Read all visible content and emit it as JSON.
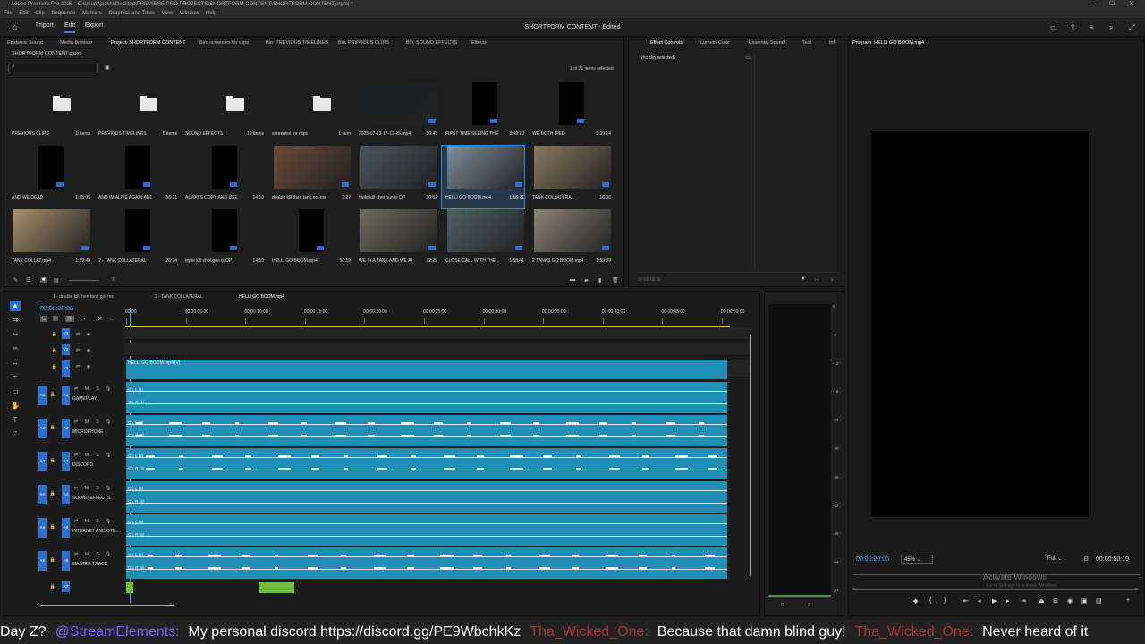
{
  "window": {
    "title": "Adobe Premiere Pro 2025 - C:\\Users\\jackm\\Desktop\\PREMIERE PRO PROJECTS\\SHORTFORM CONTENT\\SHORTFORM CONTENT.prproj *"
  },
  "menu": [
    "File",
    "Edit",
    "Clip",
    "Sequence",
    "Markers",
    "Graphics and Titles",
    "View",
    "Window",
    "Help"
  ],
  "workspace": {
    "import": "Import",
    "edit": "Edit",
    "export": "Export",
    "project_title": "SHORTFORM CONTENT - Edited"
  },
  "project_panel": {
    "tabs": [
      "Epidemic Sound",
      "Media Browser",
      "Project: SHORTFORM CONTENT",
      "Bin: screenies for clips",
      "Bin: PREVIOUS TIMELINES",
      "Bin: PREVIOUS CLIPS",
      "Bin: SOUND EFFECTS",
      "Effects"
    ],
    "file": "SHORTFORM CONTENT.prproj",
    "selection": "1 of 21 items selected",
    "items": [
      {
        "name": "PREVIOUS CLIPS",
        "info": "0 items",
        "kind": "folder"
      },
      {
        "name": "PREVIOUS TIMELINES",
        "info": "5 items",
        "kind": "folder"
      },
      {
        "name": "SOUND EFFECTS",
        "info": "10 items",
        "kind": "folder"
      },
      {
        "name": "screenies for clips",
        "info": "1 item",
        "kind": "folder"
      },
      {
        "name": "2025-07-13 17-12-25.mp4",
        "info": "56:43",
        "kind": "clip",
        "color": "#1a1e22"
      },
      {
        "name": "FIRST TIME SEEING THE ...",
        "info": "3:49:10",
        "kind": "seq",
        "color": "#050608"
      },
      {
        "name": "WE BOTH DIED",
        "info": "5:39:14",
        "kind": "seq",
        "color": "#000"
      },
      {
        "name": "AND WE DEAD",
        "info": "1:15:05",
        "kind": "seq",
        "color": "#000"
      },
      {
        "name": "AND IM ALIVE AGAIN AND...",
        "info": "56:21",
        "kind": "seq",
        "color": "#000"
      },
      {
        "name": "ALWAYS COPY AND USE F...",
        "info": "14:10",
        "kind": "seq",
        "color": "#000"
      },
      {
        "name": "double kill then tank got me",
        "info": "3:27",
        "kind": "clip",
        "color": "#6a4a3a"
      },
      {
        "name": "triple kill shot gun is OP",
        "info": "20:52",
        "kind": "clip",
        "color": "#4a5560"
      },
      {
        "name": "HELLI GO BOOM.mp4",
        "info": "1:58:21",
        "kind": "clip",
        "color": "#7e8f9c",
        "selected": true
      },
      {
        "name": "TANK COLLATERAL",
        "info": "16:06",
        "kind": "clip",
        "color": "#8a7a60"
      },
      {
        "name": "TANK COLLAT.mp4",
        "info": "1:59:40",
        "kind": "clip",
        "color": "#a8906a"
      },
      {
        "name": "2 - TANK COLLATERAL",
        "info": "26:24",
        "kind": "seq",
        "color": "#000"
      },
      {
        "name": "triple kill shot gun is OP",
        "info": "14:10",
        "kind": "seq",
        "color": "#000"
      },
      {
        "name": "HELLI GO BOOM.mp4",
        "info": "50:19",
        "kind": "seq",
        "color": "#000"
      },
      {
        "name": "WE IN A TANK AND WE AR...",
        "info": "22:29",
        "kind": "clip",
        "color": "#6e6a5e"
      },
      {
        "name": "CLOSE CALL WITH THE ...",
        "info": "1:58:41",
        "kind": "clip",
        "color": "#4f5f6a"
      },
      {
        "name": "2 TANKS GO BOOM.mp4",
        "info": "1:59:39",
        "kind": "clip",
        "color": "#8c8478"
      }
    ]
  },
  "effect_controls": {
    "tabs": [
      "Effect Controls",
      "Lumetri Color",
      "Essential Sound",
      "Text",
      "Inf"
    ],
    "no_clip": "(no clip selected)",
    "timecode": "00:00:00:00"
  },
  "program": {
    "title": "Program: HELLI GO BOOM.mp4",
    "timecode": "00:00:00:00",
    "zoom": "45%",
    "quality": "Full",
    "duration": "00:00:50:19",
    "watermark": "Activate Windows",
    "watermark_sub": "Go to Settings to activate Windows."
  },
  "timeline": {
    "tabs": [
      "1 - double kill then tank got me",
      "2 - TANK COLLATERAL",
      "HELLI GO BOOM.mp4"
    ],
    "timecode": "00:00:00:00",
    "ruler": [
      "00:00",
      "00:00:05:00",
      "00:00:10:00",
      "00:00:15:00",
      "00:00:20:00",
      "00:00:25:00",
      "00:00:30:00",
      "00:00:35:00",
      "00:00:40:00",
      "00:00:45:00",
      "00:00:50:00"
    ],
    "video_tracks": [
      "V3",
      "V2",
      "V1"
    ],
    "video_clip": "HELLI GO BOOM.mp4 [V]",
    "audio_tracks": [
      {
        "id": "A1",
        "name": "GAMEPLAY",
        "ch": [
          "Ch. L (1)",
          "Ch. R (1)"
        ]
      },
      {
        "id": "A2",
        "name": "MICROPHONE",
        "ch": [
          "Ch. L (2)",
          "Ch. R (2)"
        ]
      },
      {
        "id": "A3",
        "name": "DISCORD",
        "ch": [
          "Ch. L (3)",
          "Ch. R (3)"
        ]
      },
      {
        "id": "A4",
        "name": "SOUND EFFECTS",
        "ch": [
          "Ch. L (4)",
          "Ch. R (4)"
        ]
      },
      {
        "id": "A5",
        "name": "INTERNET AND OTH...",
        "ch": [
          "Ch. L (5)",
          "Ch. R (5)"
        ]
      },
      {
        "id": "A6",
        "name": "MASTER TRACK",
        "ch": [
          "Ch. L (6)",
          "Ch. R (6)"
        ]
      }
    ],
    "a7": "A7",
    "track_buttons": {
      "mute": "M",
      "solo": "S"
    }
  },
  "meter": {
    "scale": [
      "0",
      "-6",
      "-12",
      "-18",
      "-24",
      "-30",
      "-36",
      "-42",
      "-48",
      "-54",
      "-57"
    ],
    "footer": [
      "S",
      "S"
    ]
  },
  "chat": [
    {
      "text": "Day Z?",
      "style": "msg"
    },
    {
      "text": "@StreamElements:",
      "style": "user"
    },
    {
      "text": "My personal discord https://discord.gg/PE9WbchkKz",
      "style": "msg"
    },
    {
      "text": "Tha_Wicked_One:",
      "style": "user2"
    },
    {
      "text": "Because that damn blind guy!",
      "style": "msg"
    },
    {
      "text": "Tha_Wicked_One:",
      "style": "user2"
    },
    {
      "text": "Never heard of it",
      "style": "msg"
    }
  ],
  "colors": {
    "accent": "#2d8ceb",
    "clip": "#1f8fb5",
    "track_badge": "#2b6fd0"
  }
}
